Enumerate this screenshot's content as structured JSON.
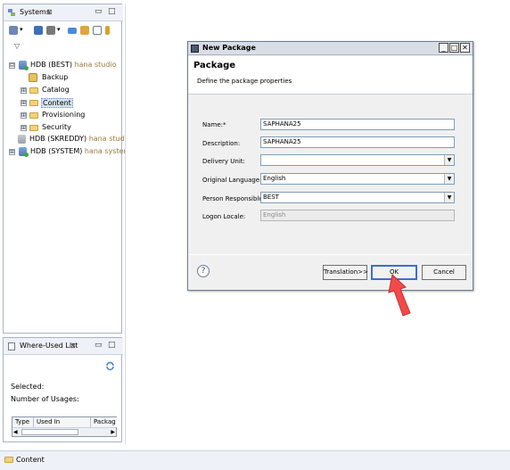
{
  "systems_view": {
    "tab_label": "Systems",
    "tab_close": "⊠",
    "minimize": "▭",
    "maximize": "□",
    "view_menu": "▽"
  },
  "tree": [
    {
      "label": "HDB (BEST)",
      "suffix": "hana studio",
      "expander": "⊟"
    },
    {
      "label": "Backup",
      "suffix": ""
    },
    {
      "label": "Catalog",
      "suffix": "",
      "expander": "⊞"
    },
    {
      "label": "Content",
      "suffix": "",
      "expander": "⊞"
    },
    {
      "label": "Provisioning",
      "suffix": "",
      "expander": "⊞"
    },
    {
      "label": "Security",
      "suffix": "",
      "expander": "⊞"
    },
    {
      "label": "HDB (SKREDDY)",
      "suffix": "hana studio"
    },
    {
      "label": "HDB (SYSTEM)",
      "suffix": "hana system",
      "expander": "⊞"
    }
  ],
  "where_used": {
    "tab_label": "Where-Used List",
    "tab_close": "⊠",
    "minimize": "▭",
    "maximize": "□",
    "selected_label": "Selected:",
    "usages_label": "Number of Usages:",
    "columns": [
      "Type",
      "Used In",
      "Packag"
    ],
    "scroll_left": "◀",
    "scroll_right": "▶"
  },
  "dialog": {
    "title": "New Package",
    "minimize": "_",
    "maximize": "□",
    "close": "✕",
    "header_title": "Package",
    "header_subtitle": "Define the package properties",
    "fields": {
      "name_label": "Name:*",
      "name_value": "SAPHANA25",
      "description_label": "Description:",
      "description_value": "SAPHANA25",
      "delivery_unit_label": "Delivery Unit:",
      "delivery_unit_value": "",
      "original_language_label": "Original Language:",
      "original_language_value": "English",
      "person_responsible_label": "Person Responsible:",
      "person_responsible_value": "BEST",
      "logon_locale_label": "Logon Locale:",
      "logon_locale_value": "English"
    },
    "dropdown_arrow": "▼",
    "help": "?",
    "translation_button": "Translation>>",
    "ok_button": "OK",
    "cancel_button": "Cancel"
  },
  "status_bar": {
    "text": "Content"
  }
}
